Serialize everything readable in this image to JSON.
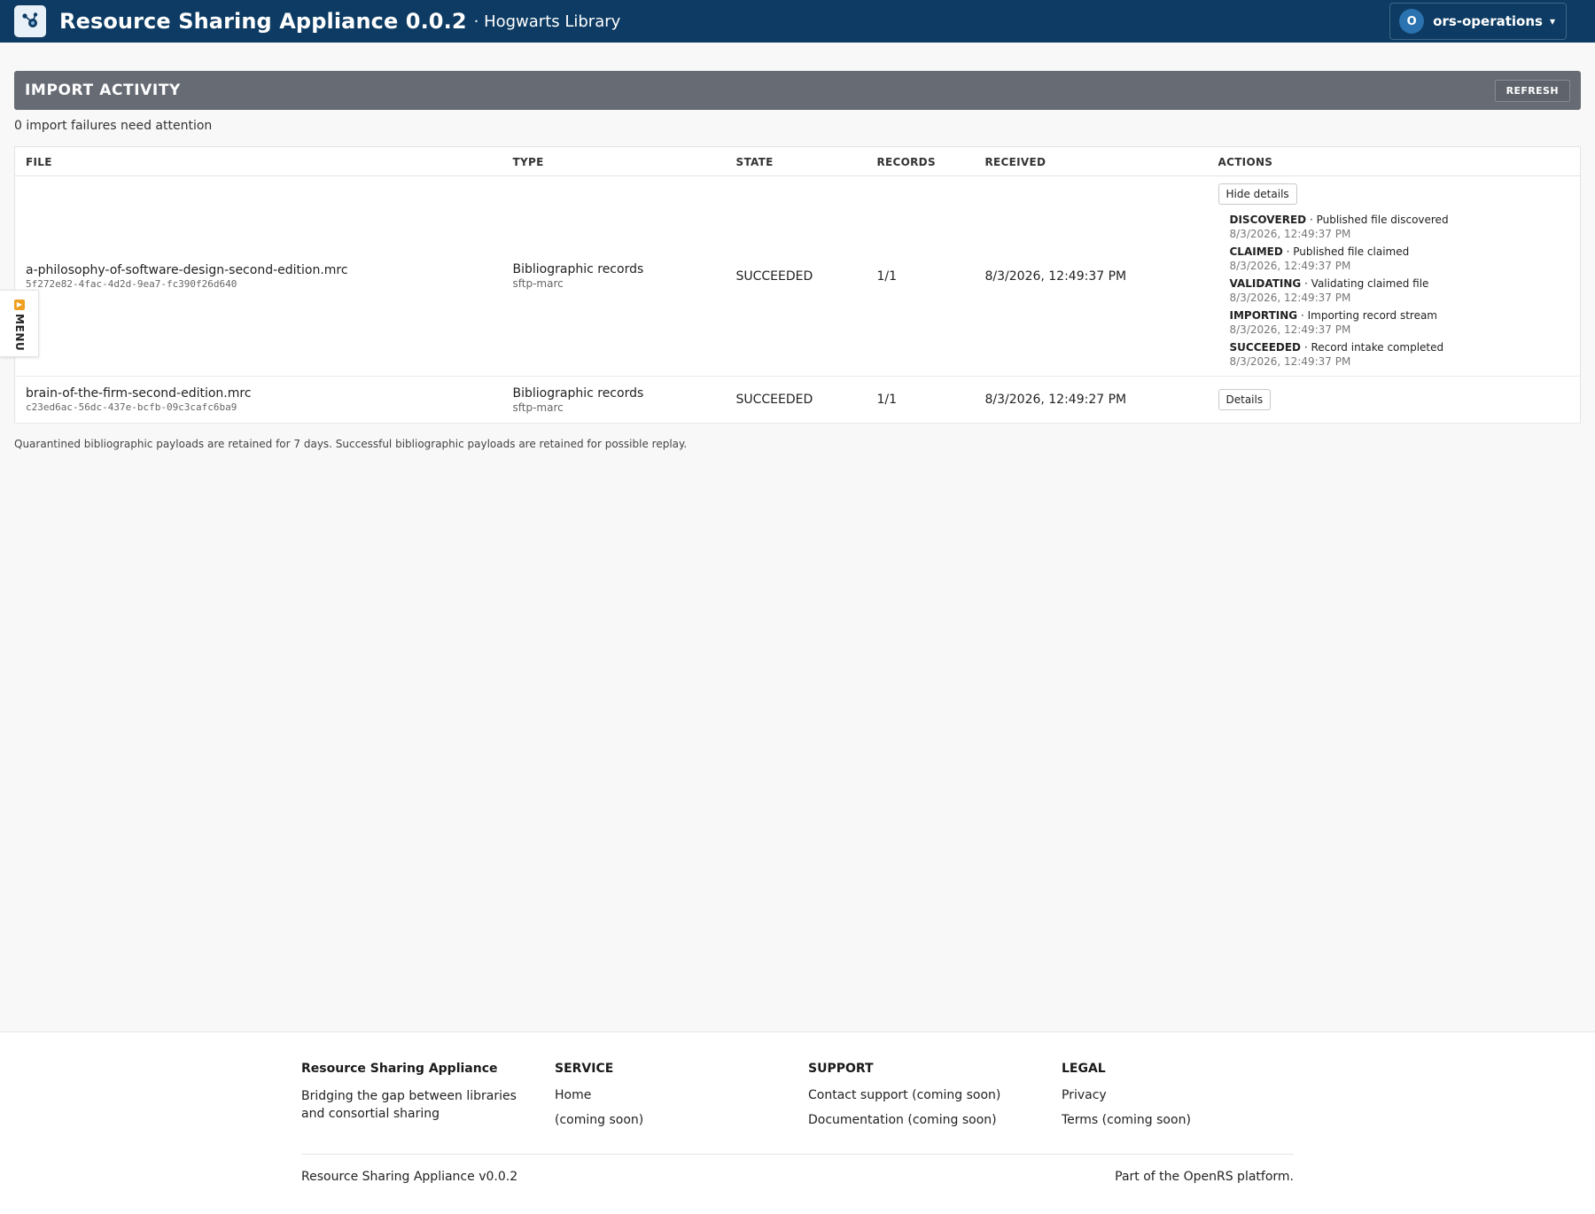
{
  "header": {
    "title": "Resource Sharing Appliance 0.0.2",
    "subtitle": "· Hogwarts Library",
    "user_initial": "O",
    "user_name": "ors-operations",
    "caret": "▾"
  },
  "side_menu": {
    "label": "MENU"
  },
  "panel": {
    "title": "IMPORT ACTIVITY",
    "refresh_label": "REFRESH",
    "attention": "0 import failures need attention"
  },
  "table": {
    "columns": [
      "FILE",
      "TYPE",
      "STATE",
      "RECORDS",
      "RECEIVED",
      "ACTIONS"
    ],
    "rows": [
      {
        "file": "a-philosophy-of-software-design-second-edition.mrc",
        "file_id": "5f272e82-4fac-4d2d-9ea7-fc390f26d640",
        "type": "Bibliographic records",
        "type_source": "sftp-marc",
        "state": "SUCCEEDED",
        "records": "1/1",
        "received": "8/3/2026, 12:49:37 PM",
        "action_label": "Hide details",
        "events": [
          {
            "status": "DISCOVERED",
            "message": " · Published file discovered",
            "time": "8/3/2026, 12:49:37 PM"
          },
          {
            "status": "CLAIMED",
            "message": " · Published file claimed",
            "time": "8/3/2026, 12:49:37 PM"
          },
          {
            "status": "VALIDATING",
            "message": " · Validating claimed file",
            "time": "8/3/2026, 12:49:37 PM"
          },
          {
            "status": "IMPORTING",
            "message": " · Importing record stream",
            "time": "8/3/2026, 12:49:37 PM"
          },
          {
            "status": "SUCCEEDED",
            "message": " · Record intake completed",
            "time": "8/3/2026, 12:49:37 PM"
          }
        ]
      },
      {
        "file": "brain-of-the-firm-second-edition.mrc",
        "file_id": "c23ed6ac-56dc-437e-bcfb-09c3cafc6ba9",
        "type": "Bibliographic records",
        "type_source": "sftp-marc",
        "state": "SUCCEEDED",
        "records": "1/1",
        "received": "8/3/2026, 12:49:27 PM",
        "action_label": "Details"
      }
    ]
  },
  "retention_note": "Quarantined bibliographic payloads are retained for 7 days. Successful bibliographic payloads are retained for possible replay.",
  "footer": {
    "brand_title": "Resource Sharing Appliance",
    "brand_tagline": "Bridging the gap between libraries and consortial sharing",
    "service": {
      "heading": "SERVICE",
      "links": [
        "Home",
        "(coming soon)"
      ]
    },
    "support": {
      "heading": "SUPPORT",
      "links": [
        "Contact support (coming soon)",
        "Documentation (coming soon)"
      ]
    },
    "legal": {
      "heading": "LEGAL",
      "links": [
        "Privacy",
        "Terms (coming soon)"
      ]
    },
    "version": "Resource Sharing Appliance v0.0.2",
    "platform": "Part of the OpenRS platform."
  }
}
